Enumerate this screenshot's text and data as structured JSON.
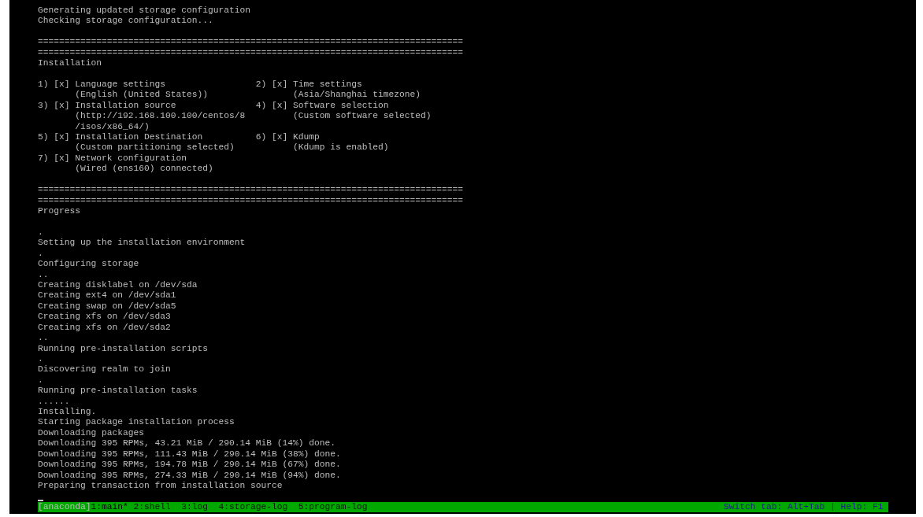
{
  "log_top": [
    "Generating updated storage configuration",
    "Checking storage configuration..."
  ],
  "installation": {
    "separators": [
      "================================================================================",
      "================================================================================"
    ],
    "title": "Installation",
    "items": [
      {
        "number": "1)",
        "mark": "[x]",
        "title": "Language settings",
        "details": [
          "(English (United States))"
        ]
      },
      {
        "number": "2)",
        "mark": "[x]",
        "title": "Time settings",
        "details": [
          "(Asia/Shanghai timezone)"
        ]
      },
      {
        "number": "3)",
        "mark": "[x]",
        "title": "Installation source",
        "details": [
          "(http://192.168.100.100/centos/8",
          "/isos/x86_64/)"
        ]
      },
      {
        "number": "4)",
        "mark": "[x]",
        "title": "Software selection",
        "details": [
          "(Custom software selected)"
        ]
      },
      {
        "number": "5)",
        "mark": "[x]",
        "title": "Installation Destination",
        "details": [
          "(Custom partitioning selected)"
        ]
      },
      {
        "number": "6)",
        "mark": "[x]",
        "title": "Kdump",
        "details": [
          "(Kdump is enabled)"
        ]
      },
      {
        "number": "7)",
        "mark": "[x]",
        "title": "Network configuration",
        "details": [
          "(Wired (ens160) connected)"
        ]
      }
    ]
  },
  "progress": {
    "separators": [
      "================================================================================",
      "================================================================================"
    ],
    "title": "Progress",
    "lines": [
      ".",
      "Setting up the installation environment",
      ".",
      "Configuring storage",
      "..",
      "Creating disklabel on /dev/sda",
      "Creating ext4 on /dev/sda1",
      "Creating swap on /dev/sda5",
      "Creating xfs on /dev/sda3",
      "Creating xfs on /dev/sda2",
      "..",
      "Running pre-installation scripts",
      ".",
      "Discovering realm to join",
      ".",
      "Running pre-installation tasks",
      "......",
      "Installing.",
      "Starting package installation process",
      "Downloading packages",
      "Downloading 395 RPMs, 43.21 MiB / 290.14 MiB (14%) done.",
      "Downloading 395 RPMs, 111.43 MiB / 290.14 MiB (38%) done.",
      "Downloading 395 RPMs, 194.78 MiB / 290.14 MiB (67%) done.",
      "Downloading 395 RPMs, 274.33 MiB / 290.14 MiB (94%) done.",
      "Preparing transaction from installation source"
    ]
  },
  "status_bar": {
    "session": "[anaconda]",
    "tabs": [
      {
        "label": "1:main*",
        "selected": true
      },
      {
        "label": "2:shell",
        "selected": false
      },
      {
        "label": "3:log",
        "selected": false
      },
      {
        "label": "4:storage-log",
        "selected": false
      },
      {
        "label": "5:program-log",
        "selected": false
      }
    ],
    "hint": "Switch tab: Alt+Tab | Help: F1"
  }
}
